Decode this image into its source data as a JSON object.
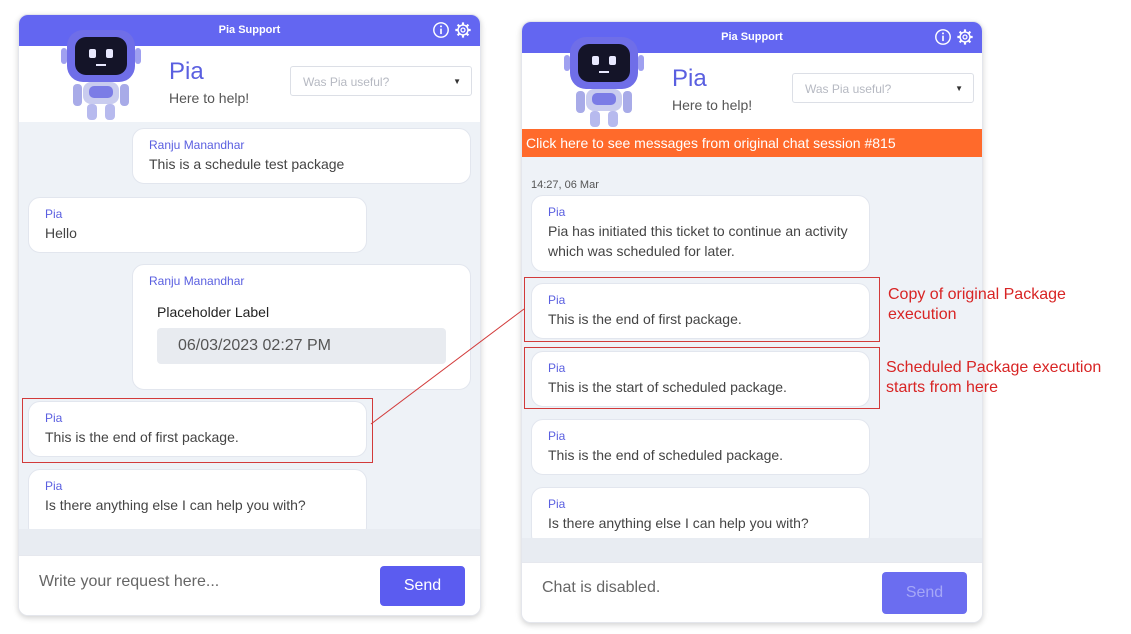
{
  "left_panel": {
    "title": "Pia Support",
    "bot_name": "Pia",
    "bot_subtitle": "Here to help!",
    "feedback_placeholder": "Was Pia useful?",
    "messages": [
      {
        "sender": "Ranju Manandhar",
        "text": "This is a schedule test package"
      },
      {
        "sender": "Pia",
        "text": "Hello"
      },
      {
        "sender": "Ranju Manandhar",
        "field_label": "Placeholder Label",
        "field_value": "06/03/2023 02:27 PM"
      },
      {
        "sender": "Pia",
        "text": "This is the end of first package."
      },
      {
        "sender": "Pia",
        "text": "Is there anything else I can help you with?"
      }
    ],
    "input_placeholder": "Write your request here...",
    "send_label": "Send"
  },
  "right_panel": {
    "title": "Pia Support",
    "bot_name": "Pia",
    "bot_subtitle": "Here to help!",
    "feedback_placeholder": "Was Pia useful?",
    "banner": "Click here to see messages from original chat session #815",
    "timestamp": "14:27, 06 Mar",
    "messages": [
      {
        "sender": "Pia",
        "text": "Pia has initiated this ticket to continue an activity which was scheduled for later."
      },
      {
        "sender": "Pia",
        "text": "This is the end of first package."
      },
      {
        "sender": "Pia",
        "text": "This is the start of scheduled package."
      },
      {
        "sender": "Pia",
        "text": "This is the end of scheduled package."
      },
      {
        "sender": "Pia",
        "text": "Is there anything else I can help you with?"
      }
    ],
    "input_placeholder": "Chat is disabled.",
    "send_label": "Send"
  },
  "annotations": {
    "copy": "Copy of original Package execution",
    "scheduled": "Scheduled Package execution starts from here"
  },
  "icons": [
    "info-icon",
    "gear-icon",
    "robot-avatar",
    "chevron-down-icon"
  ],
  "colors": {
    "accent": "#6366f1",
    "banner": "#ff6a2b",
    "annotation": "#d82424"
  }
}
